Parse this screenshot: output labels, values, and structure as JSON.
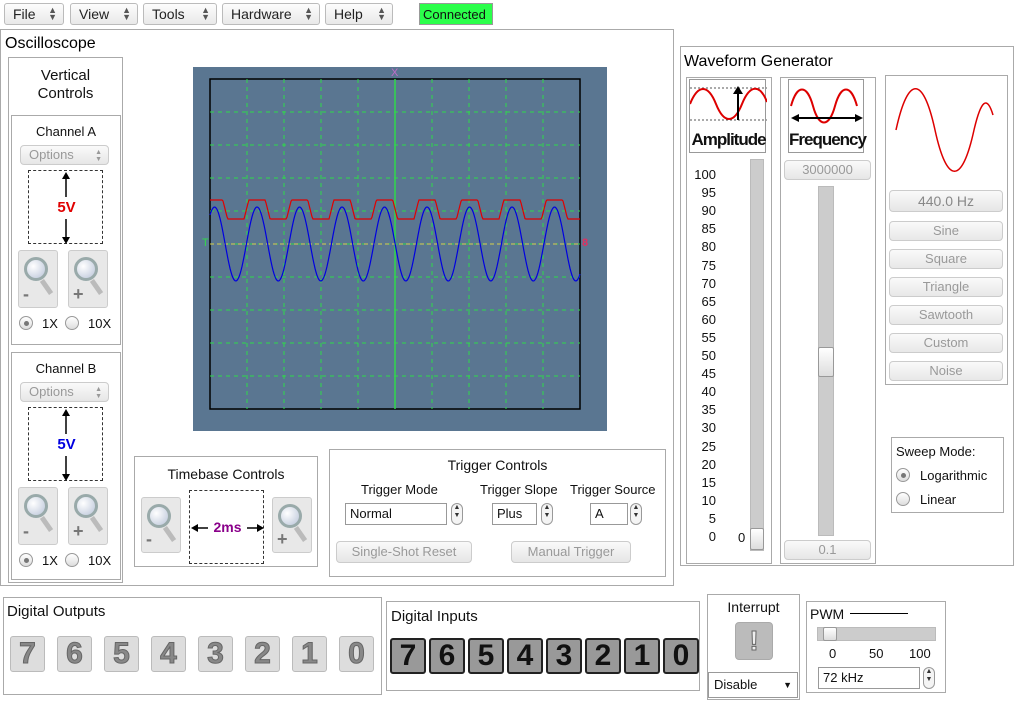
{
  "menu": {
    "file": "File",
    "view": "View",
    "tools": "Tools",
    "hardware": "Hardware",
    "help": "Help",
    "status": "Connected",
    "status_color": "#2bff4b"
  },
  "oscilloscope": {
    "title": "Oscilloscope",
    "vertical_title_1": "Vertical",
    "vertical_title_2": "Controls",
    "channel_a": {
      "label": "Channel A",
      "options": "Options",
      "scale": "5V",
      "color": "#e00000",
      "probe_1x": "1X",
      "probe_10x": "10X",
      "selected": "1X"
    },
    "channel_b": {
      "label": "Channel B",
      "options": "Options",
      "scale": "5V",
      "color": "#0000e0",
      "probe_1x": "1X",
      "probe_10x": "10X",
      "selected": "1X"
    },
    "screen": {
      "x_marker": "X",
      "trigger_marker": "T",
      "b_marker": "8"
    },
    "timebase": {
      "title": "Timebase Controls",
      "value": "2ms",
      "color": "#8a008a"
    },
    "trigger": {
      "title": "Trigger Controls",
      "mode_label": "Trigger Mode",
      "mode_value": "Normal",
      "slope_label": "Trigger Slope",
      "slope_value": "Plus",
      "source_label": "Trigger Source",
      "source_value": "A",
      "single_shot": "Single-Shot Reset",
      "manual": "Manual Trigger"
    }
  },
  "waveform": {
    "title": "Waveform Generator",
    "amplitude_label": "Amplitude",
    "frequency_label": "Frequency",
    "amp_scale": [
      "100",
      "95",
      "90",
      "85",
      "80",
      "75",
      "70",
      "65",
      "60",
      "55",
      "50",
      "45",
      "40",
      "35",
      "30",
      "25",
      "20",
      "15",
      "10",
      "5",
      "0"
    ],
    "amp_value": "0",
    "amp_level_fraction": 0.0,
    "freq_max": "3000000",
    "freq_min": "0.1",
    "freq_value": "440.0 Hz",
    "buttons": [
      "Sine",
      "Square",
      "Triangle",
      "Sawtooth",
      "Custom",
      "Noise"
    ],
    "sweep_title": "Sweep Mode:",
    "sweep_log": "Logarithmic",
    "sweep_lin": "Linear",
    "sweep_selected": "Logarithmic"
  },
  "digital_outputs": {
    "title": "Digital Outputs",
    "bits": [
      "7",
      "6",
      "5",
      "4",
      "3",
      "2",
      "1",
      "0"
    ]
  },
  "digital_inputs": {
    "title": "Digital Inputs",
    "bits": [
      "7",
      "6",
      "5",
      "4",
      "3",
      "2",
      "1",
      "0"
    ]
  },
  "interrupt": {
    "title": "Interrupt",
    "button": "!",
    "select": "Disable"
  },
  "pwm": {
    "title": "PWM",
    "ticks": [
      "0",
      "50",
      "100"
    ],
    "freq": "72 kHz",
    "level_percent": 5
  }
}
